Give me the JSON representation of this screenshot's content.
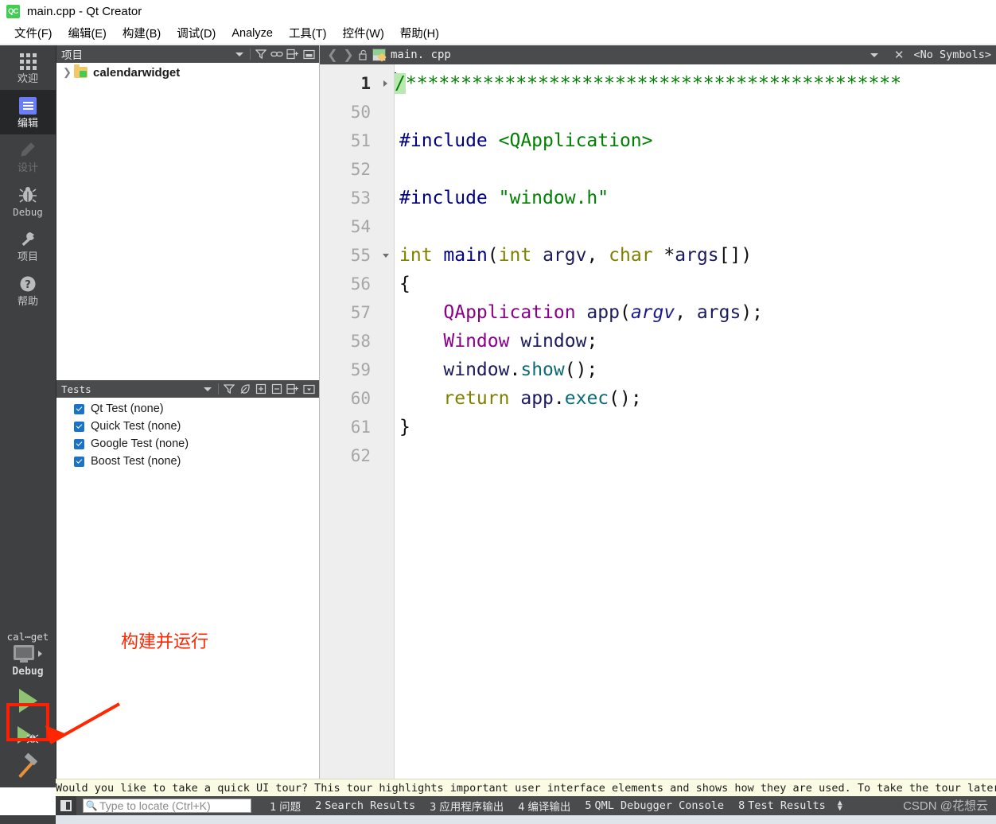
{
  "window": {
    "title": "main.cpp - Qt Creator",
    "logo_icon": "qt-logo-icon",
    "logo_text": "QC"
  },
  "menubar": {
    "items": [
      {
        "label": "文件(F)",
        "mnemonic": "F"
      },
      {
        "label": "编辑(E)",
        "mnemonic": "E"
      },
      {
        "label": "构建(B)",
        "mnemonic": "B"
      },
      {
        "label": "调试(D)",
        "mnemonic": "D"
      },
      {
        "label": "Analyze",
        "mnemonic": "A"
      },
      {
        "label": "工具(T)",
        "mnemonic": "T"
      },
      {
        "label": "控件(W)",
        "mnemonic": "W"
      },
      {
        "label": "帮助(H)",
        "mnemonic": "H"
      }
    ]
  },
  "modebar": {
    "modes": [
      {
        "label": "欢迎",
        "icon": "grid-icon",
        "state": "normal"
      },
      {
        "label": "编辑",
        "icon": "document-icon",
        "state": "selected"
      },
      {
        "label": "设计",
        "icon": "pencil-icon",
        "state": "disabled"
      },
      {
        "label": "Debug",
        "icon": "bug-icon",
        "state": "normal"
      },
      {
        "label": "项目",
        "icon": "wrench-icon",
        "state": "normal"
      },
      {
        "label": "帮助",
        "icon": "question-circle-icon",
        "state": "normal"
      }
    ],
    "kit_selector": {
      "project_name": "cal⋯get",
      "icon": "monitor-icon",
      "expand_icon": "chevron-right-icon",
      "build_config": "Debug"
    },
    "buttons": [
      {
        "name": "run-button",
        "icon": "play-icon",
        "highlighted": true
      },
      {
        "name": "debug-button",
        "icon": "play-bug-icon",
        "highlighted": false
      },
      {
        "name": "build-button",
        "icon": "hammer-icon",
        "highlighted": false
      }
    ]
  },
  "annotation": {
    "text": "构建并运行",
    "color": "#ff2600",
    "arrow_icon": "arrow-pointer-icon"
  },
  "project_dock": {
    "title": "项目",
    "toolbar": [
      {
        "name": "view-selector-dropdown",
        "icon": "chevron-down-icon"
      },
      {
        "name": "filter-button",
        "icon": "filter-icon"
      },
      {
        "name": "sync-with-editor-button",
        "icon": "link-icon"
      },
      {
        "name": "split-view-button",
        "icon": "split-plus-icon"
      },
      {
        "name": "close-dock-button",
        "icon": "dock-minimize-icon"
      }
    ],
    "tree": [
      {
        "label": "calendarwidget",
        "icon": "qt-project-folder-icon",
        "expander": "chevron-right-icon",
        "bold": true
      }
    ]
  },
  "tests_dock": {
    "title": "Tests",
    "toolbar": [
      {
        "name": "tests-view-dropdown",
        "icon": "chevron-down-icon"
      },
      {
        "name": "tests-filter-button",
        "icon": "filter-icon"
      },
      {
        "name": "tests-scan-button",
        "icon": "leaf-icon"
      },
      {
        "name": "expand-all-button",
        "icon": "plus-box-icon"
      },
      {
        "name": "collapse-all-button",
        "icon": "minus-box-icon"
      },
      {
        "name": "tests-split-button",
        "icon": "split-plus-icon"
      },
      {
        "name": "tests-options-button",
        "icon": "dropdown-box-icon"
      }
    ],
    "items": [
      {
        "label": "Qt Test (none)",
        "checked": true
      },
      {
        "label": "Quick Test (none)",
        "checked": true
      },
      {
        "label": "Google Test (none)",
        "checked": true
      },
      {
        "label": "Boost Test (none)",
        "checked": true
      }
    ]
  },
  "editor": {
    "toolbar": {
      "back_icon": "chevron-left-icon",
      "forward_icon": "chevron-right-icon",
      "lock_icon": "unlock-icon",
      "file_icon": "cpp-file-icon",
      "filename": "main. cpp",
      "dropdown_icon": "chevron-down-icon",
      "close_icon": "close-icon",
      "symbols_label": "<No Symbols>"
    },
    "lines": [
      {
        "num": "1",
        "fold": "collapsed",
        "current": true,
        "tokens": [
          {
            "t": "cursor",
            "v": ""
          },
          {
            "t": "cmt-hl",
            "v": "/"
          },
          {
            "t": "cmt",
            "v": "*********************************************"
          }
        ]
      },
      {
        "num": "50",
        "fold": "",
        "current": false,
        "tokens": []
      },
      {
        "num": "51",
        "fold": "",
        "current": false,
        "tokens": [
          {
            "t": "pp",
            "v": "#include"
          },
          {
            "t": "plain",
            "v": " "
          },
          {
            "t": "str",
            "v": "<QApplication>"
          }
        ]
      },
      {
        "num": "52",
        "fold": "",
        "current": false,
        "tokens": []
      },
      {
        "num": "53",
        "fold": "",
        "current": false,
        "tokens": [
          {
            "t": "pp",
            "v": "#include"
          },
          {
            "t": "plain",
            "v": " "
          },
          {
            "t": "str",
            "v": "\"window.h\""
          }
        ]
      },
      {
        "num": "54",
        "fold": "",
        "current": false,
        "tokens": []
      },
      {
        "num": "55",
        "fold": "expanded",
        "current": false,
        "tokens": [
          {
            "t": "type",
            "v": "int"
          },
          {
            "t": "plain",
            "v": " "
          },
          {
            "t": "fn",
            "v": "main"
          },
          {
            "t": "plain",
            "v": "("
          },
          {
            "t": "type",
            "v": "int"
          },
          {
            "t": "plain",
            "v": " "
          },
          {
            "t": "var",
            "v": "argv"
          },
          {
            "t": "plain",
            "v": ", "
          },
          {
            "t": "type",
            "v": "char"
          },
          {
            "t": "plain",
            "v": " *"
          },
          {
            "t": "var",
            "v": "args"
          },
          {
            "t": "plain",
            "v": "[])"
          }
        ]
      },
      {
        "num": "56",
        "fold": "",
        "current": false,
        "tokens": [
          {
            "t": "plain",
            "v": "{"
          }
        ]
      },
      {
        "num": "57",
        "fold": "",
        "current": false,
        "tokens": [
          {
            "t": "plain",
            "v": "    "
          },
          {
            "t": "cls",
            "v": "QApplication"
          },
          {
            "t": "plain",
            "v": " "
          },
          {
            "t": "var",
            "v": "app"
          },
          {
            "t": "plain",
            "v": "("
          },
          {
            "t": "param",
            "v": "argv"
          },
          {
            "t": "plain",
            "v": ", "
          },
          {
            "t": "var",
            "v": "args"
          },
          {
            "t": "plain",
            "v": ");"
          }
        ]
      },
      {
        "num": "58",
        "fold": "",
        "current": false,
        "tokens": [
          {
            "t": "plain",
            "v": "    "
          },
          {
            "t": "cls",
            "v": "Window"
          },
          {
            "t": "plain",
            "v": " "
          },
          {
            "t": "var",
            "v": "window"
          },
          {
            "t": "plain",
            "v": ";"
          }
        ]
      },
      {
        "num": "59",
        "fold": "",
        "current": false,
        "tokens": [
          {
            "t": "plain",
            "v": "    "
          },
          {
            "t": "var",
            "v": "window"
          },
          {
            "t": "plain",
            "v": "."
          },
          {
            "t": "call",
            "v": "show"
          },
          {
            "t": "plain",
            "v": "();"
          }
        ]
      },
      {
        "num": "60",
        "fold": "",
        "current": false,
        "tokens": [
          {
            "t": "plain",
            "v": "    "
          },
          {
            "t": "type",
            "v": "return"
          },
          {
            "t": "plain",
            "v": " "
          },
          {
            "t": "var",
            "v": "app"
          },
          {
            "t": "plain",
            "v": "."
          },
          {
            "t": "call",
            "v": "exec"
          },
          {
            "t": "plain",
            "v": "();"
          }
        ]
      },
      {
        "num": "61",
        "fold": "",
        "current": false,
        "tokens": [
          {
            "t": "plain",
            "v": "}"
          }
        ]
      },
      {
        "num": "62",
        "fold": "",
        "current": false,
        "tokens": []
      }
    ]
  },
  "tour_bar": {
    "message": "Would you like to take a quick UI tour? This tour highlights important user interface elements and shows how they are used. To take the tour later,"
  },
  "statusbar": {
    "locator_toggle_icon": "sidebar-toggle-icon",
    "search_icon": "search-icon",
    "locator_placeholder": "Type to locate (Ctrl+K)",
    "panes": [
      {
        "num": "1",
        "label": "问题",
        "cjk": true
      },
      {
        "num": "2",
        "label": "Search Results",
        "cjk": false
      },
      {
        "num": "3",
        "label": "应用程序输出",
        "cjk": true
      },
      {
        "num": "4",
        "label": "编译输出",
        "cjk": true
      },
      {
        "num": "5",
        "label": "QML Debugger Console",
        "cjk": false
      },
      {
        "num": "8",
        "label": "Test Results",
        "cjk": false
      }
    ],
    "updown_icon": "up-down-arrows-icon"
  },
  "watermark": {
    "text": "CSDN @花想云"
  }
}
